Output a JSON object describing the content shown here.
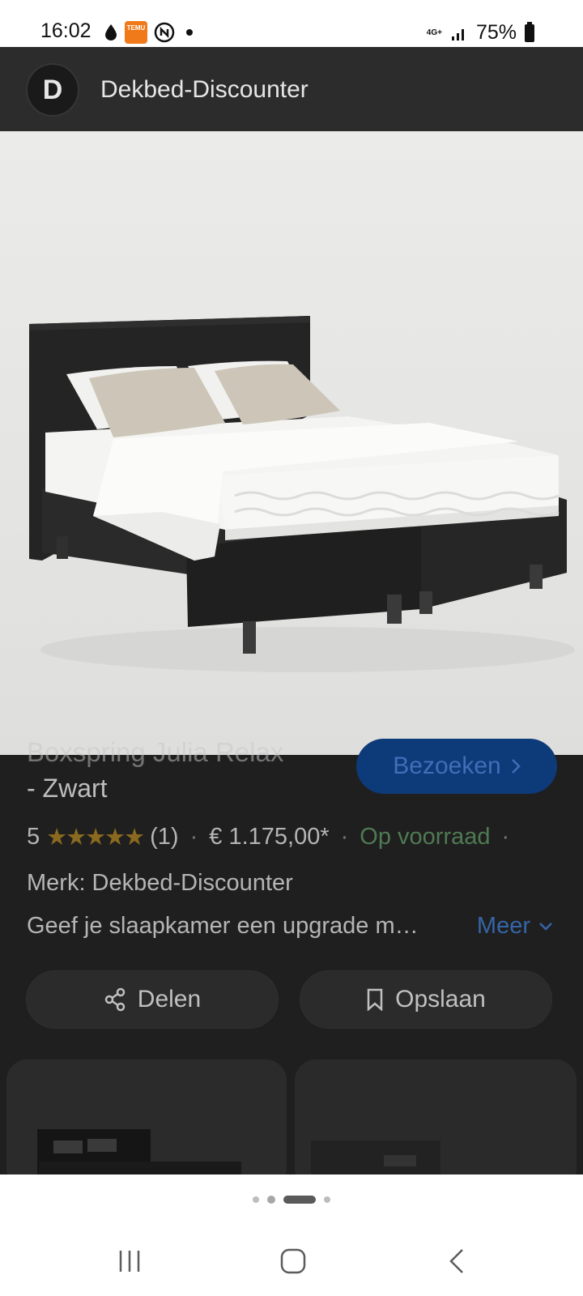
{
  "status_bar": {
    "time": "16:02",
    "icons_left": [
      "drop-icon",
      "temu-app-icon",
      "nfc-icon",
      "dot-icon"
    ],
    "temu_label": "TEMU",
    "network_label": "4G+",
    "battery": "75%"
  },
  "app_bar": {
    "logo_letter": "D",
    "title": "Dekbed-Discounter"
  },
  "product": {
    "title_line1": "Boxspring Julia Relax",
    "title_line2": "- Zwart",
    "visit_label": "Bezoeken",
    "rating": "5",
    "stars": "★★★★★",
    "review_count": "(1)",
    "price": "€ 1.175,00*",
    "stock": "Op voorraad",
    "brand": "Merk: Dekbed-Discounter",
    "description": "Geef je slaapkamer een upgrade m…",
    "more_label": "Meer",
    "share_label": "Delen",
    "save_label": "Opslaan"
  },
  "colors": {
    "accent_blue": "#0d3a78",
    "stock_green": "#4f7a53",
    "star_gold": "#8a6a1f"
  },
  "carousel": {
    "dots": 4,
    "active_index": 2
  }
}
